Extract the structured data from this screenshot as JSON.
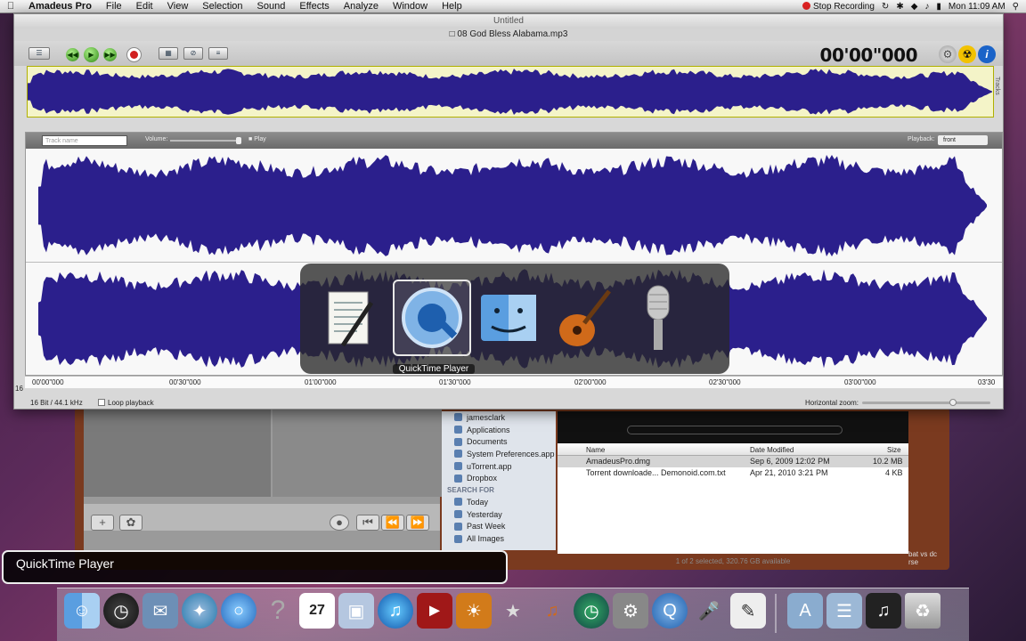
{
  "menubar": {
    "apple": "",
    "app_name": "Amadeus Pro",
    "items": [
      "File",
      "Edit",
      "View",
      "Selection",
      "Sound",
      "Effects",
      "Analyze",
      "Window",
      "Help"
    ],
    "stop_recording": "Stop Recording",
    "clock": "Mon 11:09 AM"
  },
  "window": {
    "title": "Untitled",
    "filename": "08 God Bless Alabama.mp3",
    "time_display": "00'00\"000",
    "tracks_label": "Tracks",
    "track_name_placeholder": "Track name",
    "volume_label": "Volume:",
    "play_label": "Play",
    "playback_label": "Playback:",
    "playback_value": "front",
    "ruler": [
      "00'00\"000",
      "00'30\"000",
      "01'00\"000",
      "01'30\"000",
      "02'00\"000",
      "02'30\"000",
      "03'00\"000",
      "03'30"
    ],
    "format": "16 Bit / 44.1 kHz",
    "loop_playback": "Loop playback",
    "horizontal_zoom": "Horizontal zoom:",
    "waveform_color": "#2b1f8c",
    "left_edge_label": "16"
  },
  "switcher": {
    "apps": [
      "TextEdit",
      "QuickTime Player",
      "Finder",
      "GarageBand",
      "Podcast Capture"
    ],
    "selected_label": "QuickTime Player"
  },
  "finder": {
    "sidebar": [
      "jamesclark",
      "Applications",
      "Documents",
      "System Preferences.app",
      "uTorrent.app",
      "Dropbox"
    ],
    "search_header": "SEARCH FOR",
    "search_items": [
      "Today",
      "Yesterday",
      "Past Week",
      "All Images"
    ],
    "columns": {
      "name": "Name",
      "date": "Date Modified",
      "size": "Size"
    },
    "files": [
      {
        "name": "AmadeusPro.dmg",
        "date": "Sep 6, 2009 12:02 PM",
        "size": "10.2 MB"
      },
      {
        "name": "Torrent downloade... Demonoid.com.txt",
        "date": "Apr 21, 2010 3:21 PM",
        "size": "4 KB"
      }
    ],
    "status": "1 of 2 selected, 320.76 GB available",
    "side_text": "bat vs dc\nrse"
  },
  "quicktime_bar": "QuickTime Player",
  "dock": [
    "Finder",
    "Dashboard",
    "Mail",
    "Safari",
    "iChat",
    "Help",
    "iCal",
    "Preview",
    "iTunes",
    "Front Row",
    "iPhoto",
    "iMovie",
    "GarageBand",
    "Time Machine",
    "System Preferences",
    "QuickTime Player",
    "Podcast",
    "TextEdit",
    "Applications",
    "Documents",
    "Music",
    "Trash"
  ]
}
